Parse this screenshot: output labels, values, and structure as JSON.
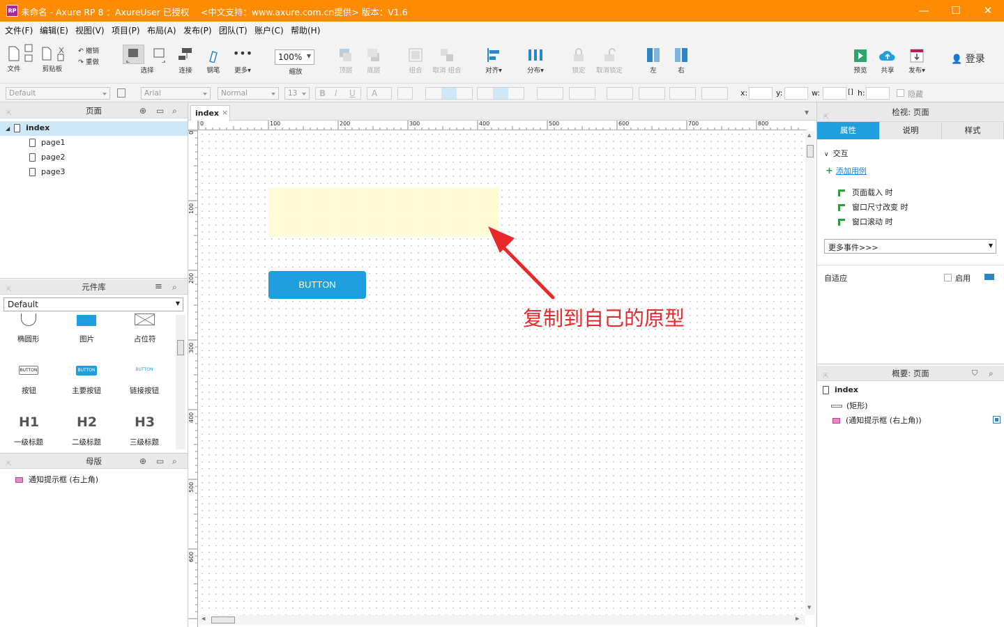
{
  "window": {
    "title": "未命名 - Axure RP 8 ：AxureUser 已授权　 <中文支持：www.axure.com.cn提供> 版本：V1.6",
    "logo": "RP",
    "min": "—",
    "max": "☐",
    "close": "✕"
  },
  "menu": [
    "文件(F)",
    "编辑(E)",
    "视图(V)",
    "项目(P)",
    "布局(A)",
    "发布(P)",
    "团队(T)",
    "账户(C)",
    "帮助(H)"
  ],
  "toolbar": {
    "file": "文件",
    "clipboard": "剪贴板",
    "undo": "撤销",
    "redo": "重做",
    "select": "选择",
    "connect": "连接",
    "pen": "钢笔",
    "more": "更多▾",
    "zoom_value": "100%",
    "zoom": "缩放",
    "top": "顶层",
    "bottom": "底层",
    "group": "组合",
    "ungroup": "取消 组合",
    "align": "对齐▾",
    "distribute": "分布▾",
    "lock": "锁定",
    "unlock": "取消锁定",
    "left": "左",
    "right": "右",
    "preview": "预览",
    "share": "共享",
    "publish": "发布▾",
    "login": "登录"
  },
  "format": {
    "style": "Default",
    "font": "Arial",
    "weight": "Normal",
    "size": "13",
    "x": "x:",
    "y": "y:",
    "w": "w:",
    "h": "h:",
    "hide": "隐藏"
  },
  "pages": {
    "title": "页面",
    "root": "index",
    "children": [
      "page1",
      "page2",
      "page3"
    ]
  },
  "library": {
    "title": "元件库",
    "selected": "Default",
    "items": [
      {
        "label": "椭圆形",
        "icon": "ellipse-icon"
      },
      {
        "label": "图片",
        "icon": "image-icon"
      },
      {
        "label": "占位符",
        "icon": "placeholder-icon"
      },
      {
        "label": "按钮",
        "icon": "button-icon",
        "glyph": "BUTTON"
      },
      {
        "label": "主要按钮",
        "icon": "primary-button-icon",
        "glyph": "BUTTON"
      },
      {
        "label": "链接按钮",
        "icon": "link-button-icon",
        "glyph": "BUTTON"
      },
      {
        "label": "一级标题",
        "icon": "h1-icon",
        "glyph": "H1"
      },
      {
        "label": "二级标题",
        "icon": "h2-icon",
        "glyph": "H2"
      },
      {
        "label": "三级标题",
        "icon": "h3-icon",
        "glyph": "H3"
      }
    ]
  },
  "masters": {
    "title": "母版",
    "items": [
      "通知提示框 (右上角)"
    ]
  },
  "tab": {
    "name": "index",
    "close": "×"
  },
  "ruler": {
    "top": [
      "0",
      "100",
      "200",
      "300",
      "400",
      "500",
      "600",
      "700",
      "800"
    ],
    "left": [
      "0",
      "100",
      "200",
      "300",
      "400",
      "500",
      "600"
    ]
  },
  "canvas": {
    "button_label": "BUTTON",
    "annotation": "复制到自己的原型",
    "note_color": "#fdfccf",
    "button_color": "#1f9fdd",
    "arrow_color": "#e8282b"
  },
  "inspector": {
    "title": "检视: 页面",
    "tabs": [
      "属性",
      "说明",
      "样式"
    ],
    "interaction": "交互",
    "add_case": "添加用例",
    "events": [
      "页面载入 时",
      "窗口尺寸改变 时",
      "窗口滚动 时"
    ],
    "more_events": "更多事件>>>",
    "adaptive": "自适应",
    "enable": "启用"
  },
  "outline": {
    "title": "概要: 页面",
    "root": "index",
    "items": [
      "(矩形)",
      "(通知提示框 (右上角))"
    ]
  }
}
